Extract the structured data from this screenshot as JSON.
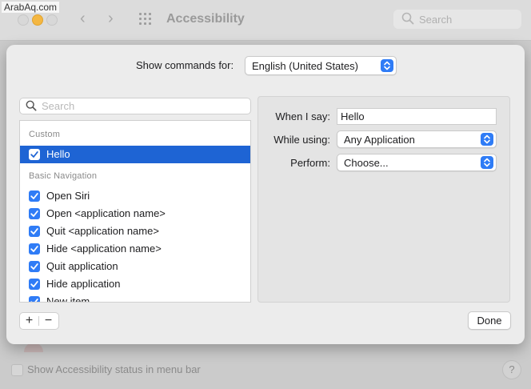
{
  "watermark": "ArabAq.com",
  "window": {
    "title": "Accessibility",
    "search_placeholder": "Search",
    "status_checkbox_label": "Show Accessibility status in menu bar",
    "help_label": "?"
  },
  "sheet": {
    "show_commands_label": "Show commands for:",
    "language_value": "English (United States)",
    "search_placeholder": "Search",
    "groups": [
      {
        "header": "Custom",
        "items": [
          {
            "label": "Hello",
            "checked": true,
            "selected": true
          }
        ]
      },
      {
        "header": "Basic Navigation",
        "items": [
          {
            "label": "Open Siri",
            "checked": true
          },
          {
            "label": "Open <application name>",
            "checked": true
          },
          {
            "label": "Quit <application name>",
            "checked": true
          },
          {
            "label": "Hide <application name>",
            "checked": true
          },
          {
            "label": "Quit application",
            "checked": true
          },
          {
            "label": "Hide application",
            "checked": true
          },
          {
            "label": "New item",
            "checked": true
          }
        ]
      }
    ],
    "add_label": "+",
    "remove_label": "−",
    "detail": {
      "when_label": "When I say:",
      "when_value": "Hello",
      "while_label": "While using:",
      "while_value": "Any Application",
      "perform_label": "Perform:",
      "perform_value": "Choose..."
    },
    "done_label": "Done"
  },
  "colors": {
    "accent": "#2f7cf6",
    "selection": "#1e64d4",
    "traffic_yellow": "#f4b742"
  },
  "icons": {
    "search": "magnifying-glass",
    "stepper": "up-down-chevron",
    "checkbox": "checkmark",
    "nav_back": "chevron-left",
    "nav_forward": "chevron-right",
    "grid": "app-grid"
  }
}
